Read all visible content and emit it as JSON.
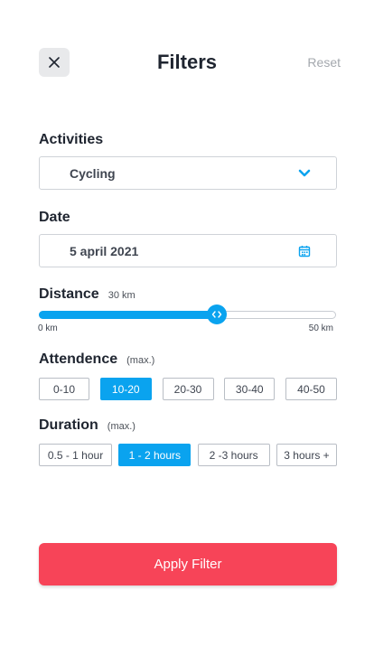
{
  "header": {
    "title": "Filters",
    "reset_label": "Reset",
    "close_icon": "close-icon"
  },
  "activities": {
    "label": "Activities",
    "selected": "Cycling",
    "icon": "chevron-down-icon"
  },
  "date": {
    "label": "Date",
    "value": "5 april 2021",
    "icon": "calendar-icon"
  },
  "distance": {
    "label": "Distance",
    "current": "30 km",
    "min_label": "0 km",
    "max_label": "50 km",
    "value_km": 30,
    "min_km": 0,
    "max_km": 50
  },
  "attendence": {
    "label": "Attendence",
    "qualifier": "(max.)",
    "options": [
      "0-10",
      "10-20",
      "20-30",
      "30-40",
      "40-50"
    ],
    "selected_index": 1
  },
  "duration": {
    "label": "Duration",
    "qualifier": "(max.)",
    "options": [
      "0.5 - 1 hour",
      "1 - 2 hours",
      "2 -3 hours",
      "3 hours +"
    ],
    "selected_index": 1
  },
  "apply_label": "Apply Filter",
  "colors": {
    "accent": "#0aa3ef",
    "apply": "#f74458",
    "text": "#1f2530",
    "muted": "#a4a8ae"
  }
}
